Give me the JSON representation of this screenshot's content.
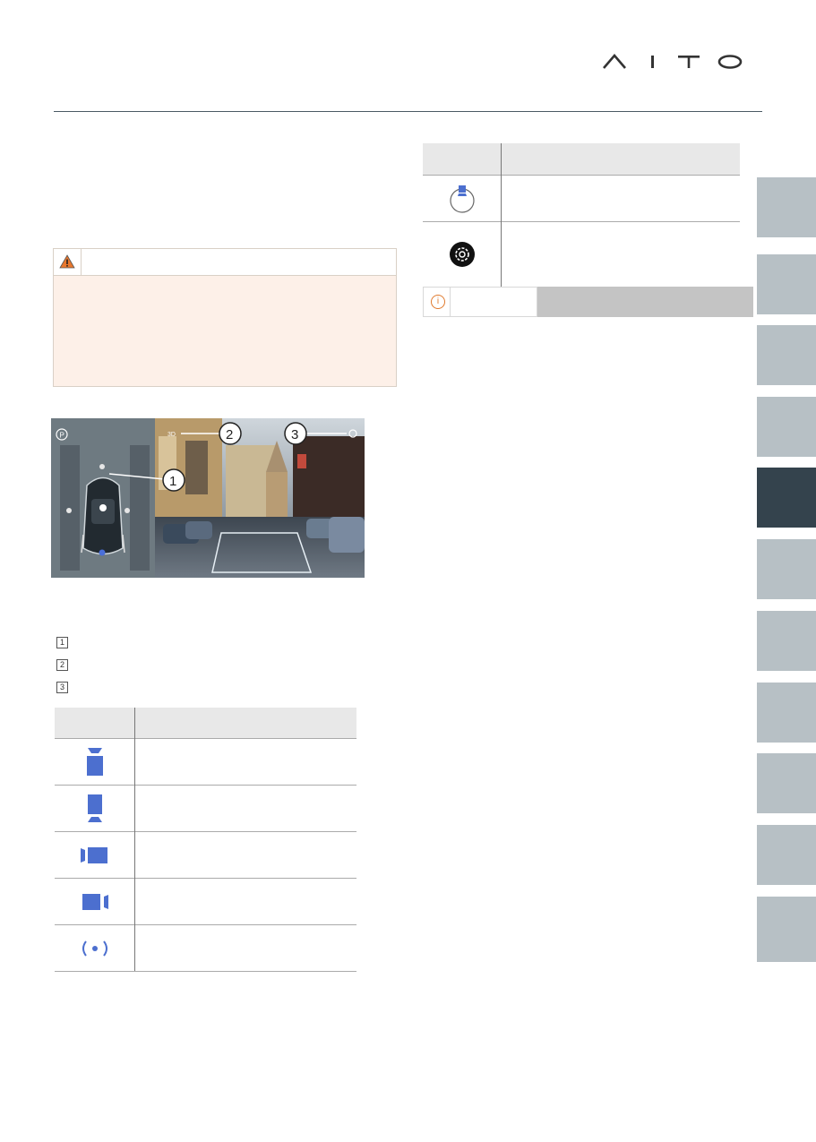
{
  "brand": {
    "logo_text": "AITO",
    "accent_color": "#34434d"
  },
  "warning": {
    "icon": "warning-triangle-icon",
    "icon_color": "#e8772e"
  },
  "camera_view": {
    "labels": [
      {
        "number": "1"
      },
      {
        "number": "2"
      },
      {
        "number": "3"
      }
    ],
    "view_mode_label": "3D",
    "icons": [
      "parking-icon",
      "settings-icon"
    ]
  },
  "callout_list": [
    "1",
    "2",
    "3"
  ],
  "left_table": {
    "rows": [
      {
        "icon": "front-camera-icon"
      },
      {
        "icon": "rear-camera-icon"
      },
      {
        "icon": "left-camera-icon"
      },
      {
        "icon": "right-camera-icon"
      },
      {
        "icon": "sensor-icon"
      }
    ]
  },
  "right_table": {
    "rows": [
      {
        "icon": "camera-view-indicator-icon"
      },
      {
        "icon": "settings-icon"
      }
    ]
  },
  "note": {
    "icon": "info-icon",
    "icon_color": "#e07a2e",
    "glyph": "i"
  },
  "side_tabs": {
    "count": 11,
    "active_index": 4
  }
}
